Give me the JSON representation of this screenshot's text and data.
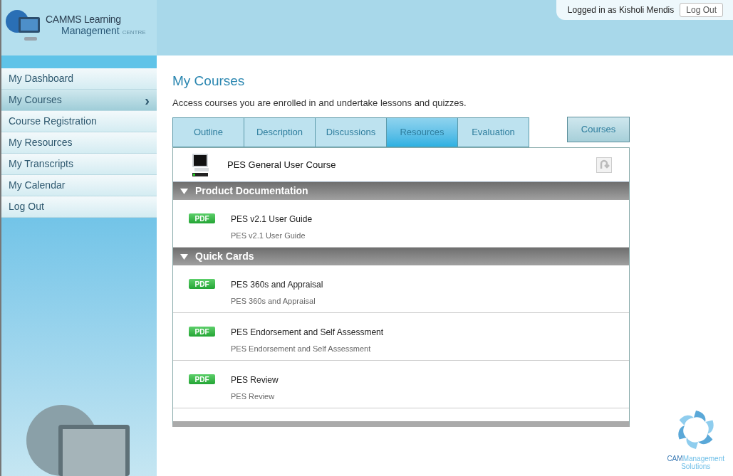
{
  "logo": {
    "line1": "CAMMS Learning",
    "line2": "Management",
    "line3": "CENTRE"
  },
  "user": {
    "text": "Logged in as Kisholi Mendis",
    "logout": "Log Out"
  },
  "sidebar": {
    "items": [
      {
        "label": "My Dashboard",
        "selected": false
      },
      {
        "label": "My Courses",
        "selected": true,
        "chevron": "›"
      },
      {
        "label": "Course Registration",
        "selected": false
      },
      {
        "label": "My Resources",
        "selected": false
      },
      {
        "label": "My Transcripts",
        "selected": false
      },
      {
        "label": "My Calendar",
        "selected": false
      },
      {
        "label": "Log Out",
        "selected": false
      }
    ]
  },
  "page": {
    "title": "My Courses",
    "subtitle": "Access courses you are enrolled in and undertake lessons and quizzes."
  },
  "tabs": [
    {
      "label": "Outline",
      "selected": false
    },
    {
      "label": "Description",
      "selected": false
    },
    {
      "label": "Discussions",
      "selected": false
    },
    {
      "label": "Resources",
      "selected": true
    },
    {
      "label": "Evaluation",
      "selected": false
    }
  ],
  "courses_button": "Courses",
  "course": {
    "name": "PES General User Course"
  },
  "sections": [
    {
      "title": "Product Documentation",
      "expanded": true,
      "items": [
        {
          "badge": "PDF",
          "title": "PES v2.1 User Guide",
          "description": "PES v2.1 User Guide"
        }
      ]
    },
    {
      "title": "Quick Cards",
      "expanded": true,
      "items": [
        {
          "badge": "PDF",
          "title": "PES 360s and Appraisal",
          "description": "PES 360s and Appraisal"
        },
        {
          "badge": "PDF",
          "title": "PES Endorsement and Self Assessment",
          "description": "PES Endorsement and Self Assessment"
        },
        {
          "badge": "PDF",
          "title": "PES Review",
          "description": "PES Review"
        }
      ]
    }
  ],
  "footer_logo": {
    "brand_a": "CAM",
    "brand_b": "Management",
    "line2": "Solutions"
  }
}
